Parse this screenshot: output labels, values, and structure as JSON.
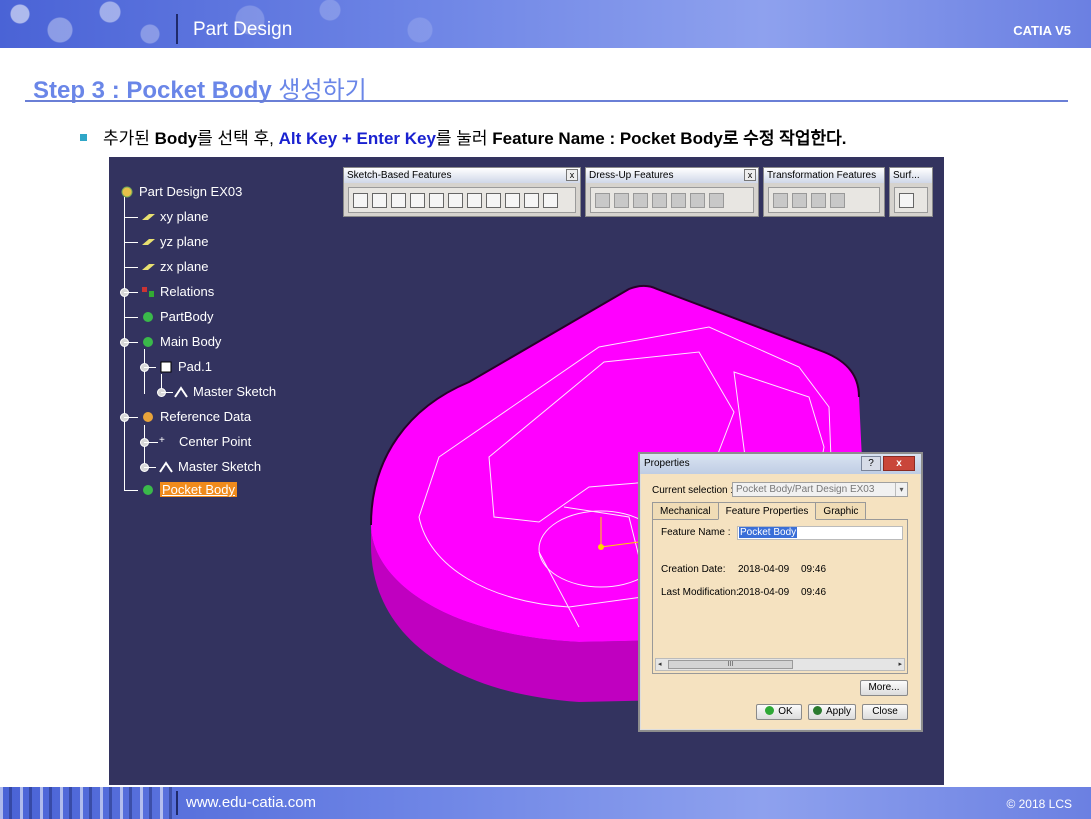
{
  "header": {
    "title": "Part Design",
    "brand": "CATIA V5"
  },
  "slide": {
    "title_en": "Step 3 : Pocket Body",
    "title_ko": "생성하기",
    "bullet": {
      "t1": "추가된 ",
      "t2": "Body",
      "t3": "를 선택 후, ",
      "t4": "Alt Key + Enter Key",
      "t5": "를 눌러 ",
      "t6": "Feature Name : Pocket  Body",
      "t7": "로 수정 작업한다."
    }
  },
  "tree": {
    "root": "Part Design EX03",
    "xy": "xy plane",
    "yz": "yz plane",
    "zx": "zx plane",
    "relations": "Relations",
    "partbody": "PartBody",
    "mainbody": "Main Body",
    "pad": "Pad.1",
    "master_sketch_1": "Master Sketch",
    "reference": "Reference Data",
    "center": "Center Point",
    "master_sketch_2": "Master Sketch",
    "pocket": "Pocket Body"
  },
  "toolbars": {
    "sketch": "Sketch-Based Features",
    "dressup": "Dress-Up Features",
    "transform": "Transformation Features",
    "surf": "Surf...",
    "close": "x"
  },
  "dialog": {
    "title": "Properties",
    "help": "?",
    "close": "x",
    "current_selection_label": "Current selection :",
    "current_selection_value": "Pocket Body/Part Design EX03",
    "tabs": [
      "Mechanical",
      "Feature Properties",
      "Graphic"
    ],
    "feature_name_label": "Feature Name :",
    "feature_name_value": "Pocket Body",
    "creation_label": "Creation Date:",
    "creation_date": "2018-04-09",
    "creation_time": "09:46",
    "modification_label": "Last Modification:",
    "modification_date": "2018-04-09",
    "modification_time": "09:46",
    "scroll_thumb": "III",
    "more": "More...",
    "ok": "OK",
    "apply": "Apply",
    "close_btn": "Close"
  },
  "footer": {
    "url": "www.edu-catia.com",
    "copyright": "© 2018 LCS"
  },
  "colors": {
    "accent": "#6a86e8",
    "part": "#ff00ff",
    "viewport": "#33335f",
    "selection": "#f08b1c"
  }
}
